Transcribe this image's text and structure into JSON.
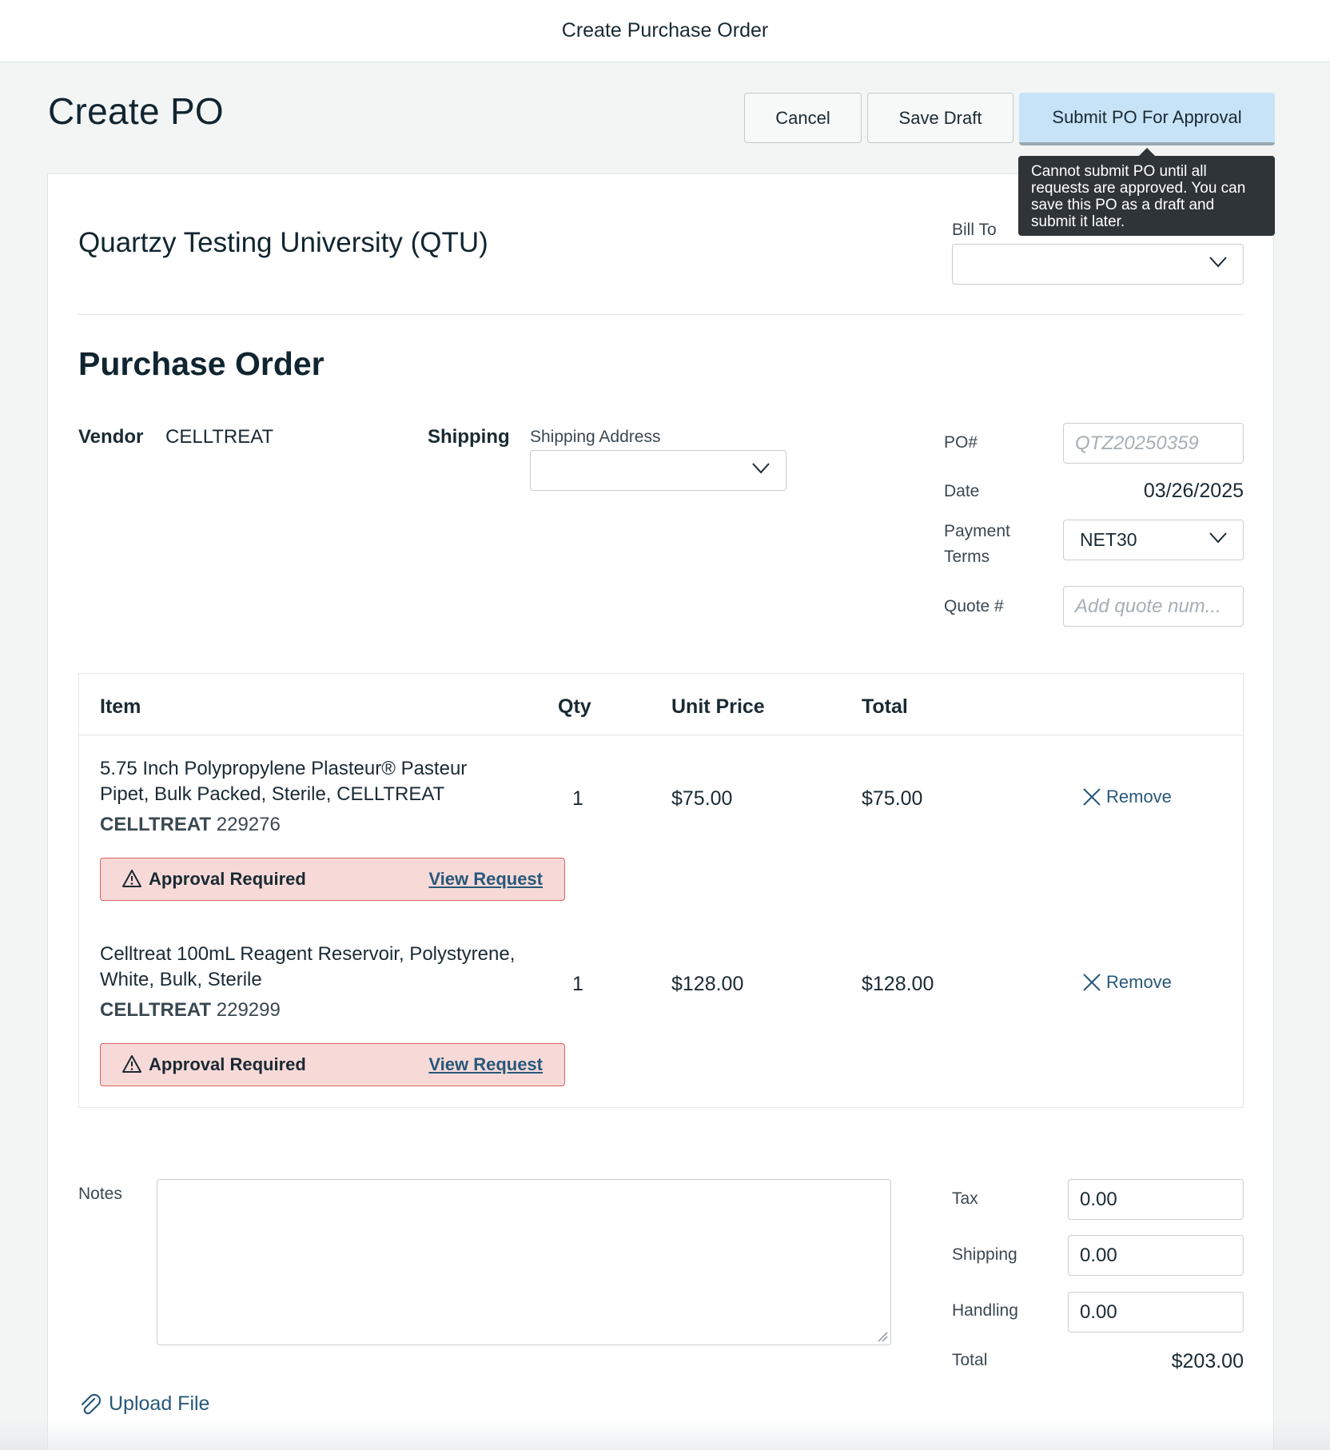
{
  "topbar": {
    "title": "Create Purchase Order"
  },
  "page": {
    "title": "Create PO"
  },
  "actions": {
    "cancel": "Cancel",
    "save_draft": "Save Draft",
    "submit": "Submit PO For Approval",
    "tooltip": "Cannot submit PO until all requests are approved. You can save this PO as a draft and submit it later."
  },
  "org": {
    "name": "Quartzy Testing University (QTU)"
  },
  "bill_to": {
    "label": "Bill To",
    "value": ""
  },
  "section": {
    "title": "Purchase Order"
  },
  "vendor": {
    "label": "Vendor",
    "value": "CELLTREAT"
  },
  "shipping": {
    "label": "Shipping",
    "address_label": "Shipping Address",
    "address_value": ""
  },
  "meta": {
    "po_label": "PO#",
    "po_placeholder": "QTZ20250359",
    "date_label": "Date",
    "date_value": "03/26/2025",
    "terms_label": "Payment Terms",
    "terms_value": "NET30",
    "quote_label": "Quote #",
    "quote_placeholder": "Add quote num..."
  },
  "table": {
    "headers": {
      "item": "Item",
      "qty": "Qty",
      "unit_price": "Unit Price",
      "total": "Total"
    },
    "rows": [
      {
        "name": "5.75 Inch Polypropylene Plasteur® Pasteur Pipet, Bulk Packed, Sterile, CELLTREAT",
        "brand": "CELLTREAT",
        "sku": "229276",
        "qty": "1",
        "unit_price": "$75.00",
        "total": "$75.00",
        "remove": "Remove",
        "alert": "Approval Required",
        "alert_link": "View Request"
      },
      {
        "name": "Celltreat 100mL Reagent Reservoir, Polystyrene, White, Bulk, Sterile",
        "brand": "CELLTREAT",
        "sku": "229299",
        "qty": "1",
        "unit_price": "$128.00",
        "total": "$128.00",
        "remove": "Remove",
        "alert": "Approval Required",
        "alert_link": "View Request"
      }
    ]
  },
  "notes": {
    "label": "Notes",
    "value": ""
  },
  "summary": {
    "tax_label": "Tax",
    "tax_value": "0.00",
    "shipping_label": "Shipping",
    "shipping_value": "0.00",
    "handling_label": "Handling",
    "handling_value": "0.00",
    "total_label": "Total",
    "total_value": "$203.00"
  },
  "upload": {
    "label": "Upload File"
  },
  "colors": {
    "accent": "#27587a",
    "submit_bg": "#c7e3f7",
    "alert_bg": "#f7dad8",
    "alert_border": "#d9625e",
    "tooltip_bg": "#2e3438"
  }
}
